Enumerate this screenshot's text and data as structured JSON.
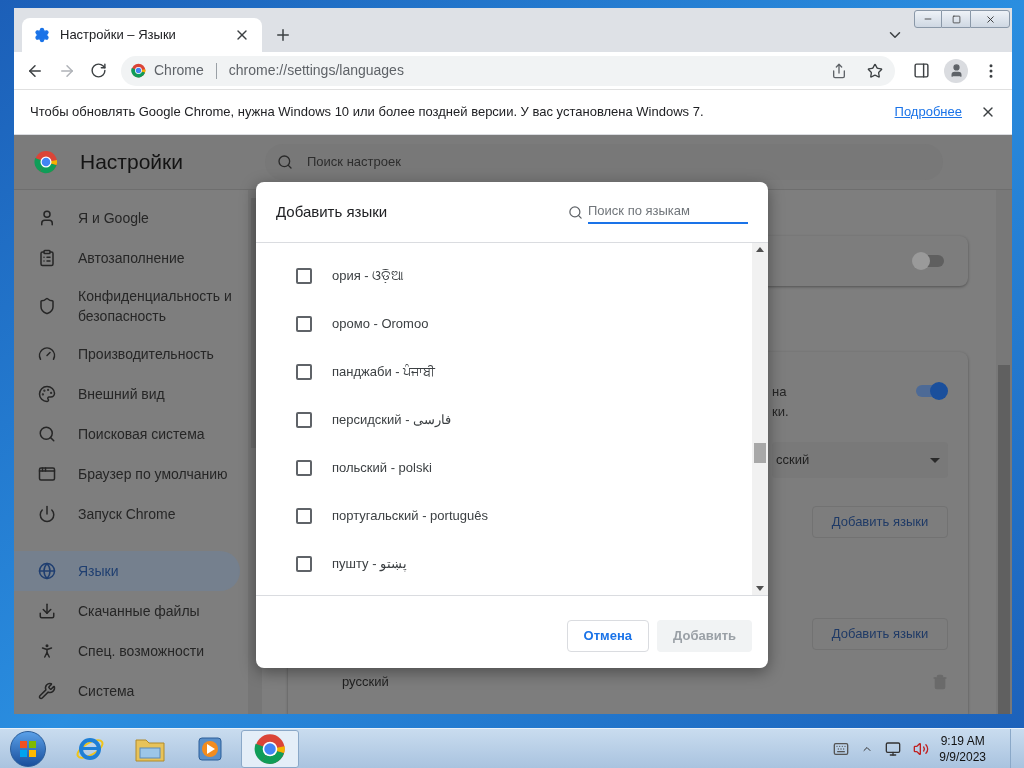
{
  "tabs": [
    {
      "title": "Настройки – Языки",
      "selected": true
    }
  ],
  "address_bar": {
    "site_label": "Chrome",
    "url": "chrome://settings/languages"
  },
  "infobar": {
    "message": "Чтобы обновлять Google Chrome, нужна Windows 10 или более поздней версии. У вас установлена Windows 7.",
    "link": "Подробнее"
  },
  "settings": {
    "title": "Настройки",
    "search_placeholder": "Поиск настроек",
    "sidebar": [
      {
        "items": [
          {
            "label": "Я и Google",
            "kind": "person",
            "selected": false
          },
          {
            "label": "Автозаполнение",
            "kind": "clipboard",
            "selected": false
          },
          {
            "label": "Конфиденциальность и безопасность",
            "kind": "shield",
            "selected": false
          },
          {
            "label": "Производительность",
            "kind": "gauge",
            "selected": false
          },
          {
            "label": "Внешний вид",
            "kind": "palette",
            "selected": false
          },
          {
            "label": "Поисковая система",
            "kind": "search",
            "selected": false
          },
          {
            "label": "Браузер по умолчанию",
            "kind": "browser",
            "selected": false
          },
          {
            "label": "Запуск Chrome",
            "kind": "power",
            "selected": false
          }
        ]
      },
      {
        "items": [
          {
            "label": "Языки",
            "kind": "globe",
            "selected": true
          },
          {
            "label": "Скачанные файлы",
            "kind": "download",
            "selected": false
          },
          {
            "label": "Спец. возможности",
            "kind": "accessibility",
            "selected": false
          },
          {
            "label": "Система",
            "kind": "wrench",
            "selected": false
          }
        ]
      }
    ]
  },
  "page": {
    "top_toggle": {
      "on": false
    },
    "text_fragments": [
      "на",
      "ки."
    ],
    "translate_toggle": {
      "on": true
    },
    "select_value": "сский",
    "add_buttons": [
      "Добавить языки",
      "Добавить языки"
    ],
    "language_row": "русский"
  },
  "dialog": {
    "title": "Добавить языки",
    "search_placeholder": "Поиск по языкам",
    "languages": [
      {
        "label": "ория - ଓଡ଼ିଆ",
        "checked": false
      },
      {
        "label": "оромо - Oromoo",
        "checked": false
      },
      {
        "label": "панджаби - ਪੰਜਾਬੀ",
        "checked": false
      },
      {
        "label": "персидский - فارسی",
        "checked": false
      },
      {
        "label": "польский - polski",
        "checked": false
      },
      {
        "label": "португальский - português",
        "checked": false
      },
      {
        "label": "пушту - پښتو",
        "checked": false
      }
    ],
    "buttons": [
      {
        "label": "Отмена",
        "disabled": false
      },
      {
        "label": "Добавить",
        "disabled": true
      }
    ]
  },
  "taskbar": {
    "apps": [
      {
        "kind": "ie",
        "selected": false
      },
      {
        "kind": "explorer",
        "selected": false
      },
      {
        "kind": "media",
        "selected": false
      },
      {
        "kind": "chrome",
        "selected": true
      }
    ],
    "time": "9:19 AM",
    "date": "9/9/2023"
  }
}
